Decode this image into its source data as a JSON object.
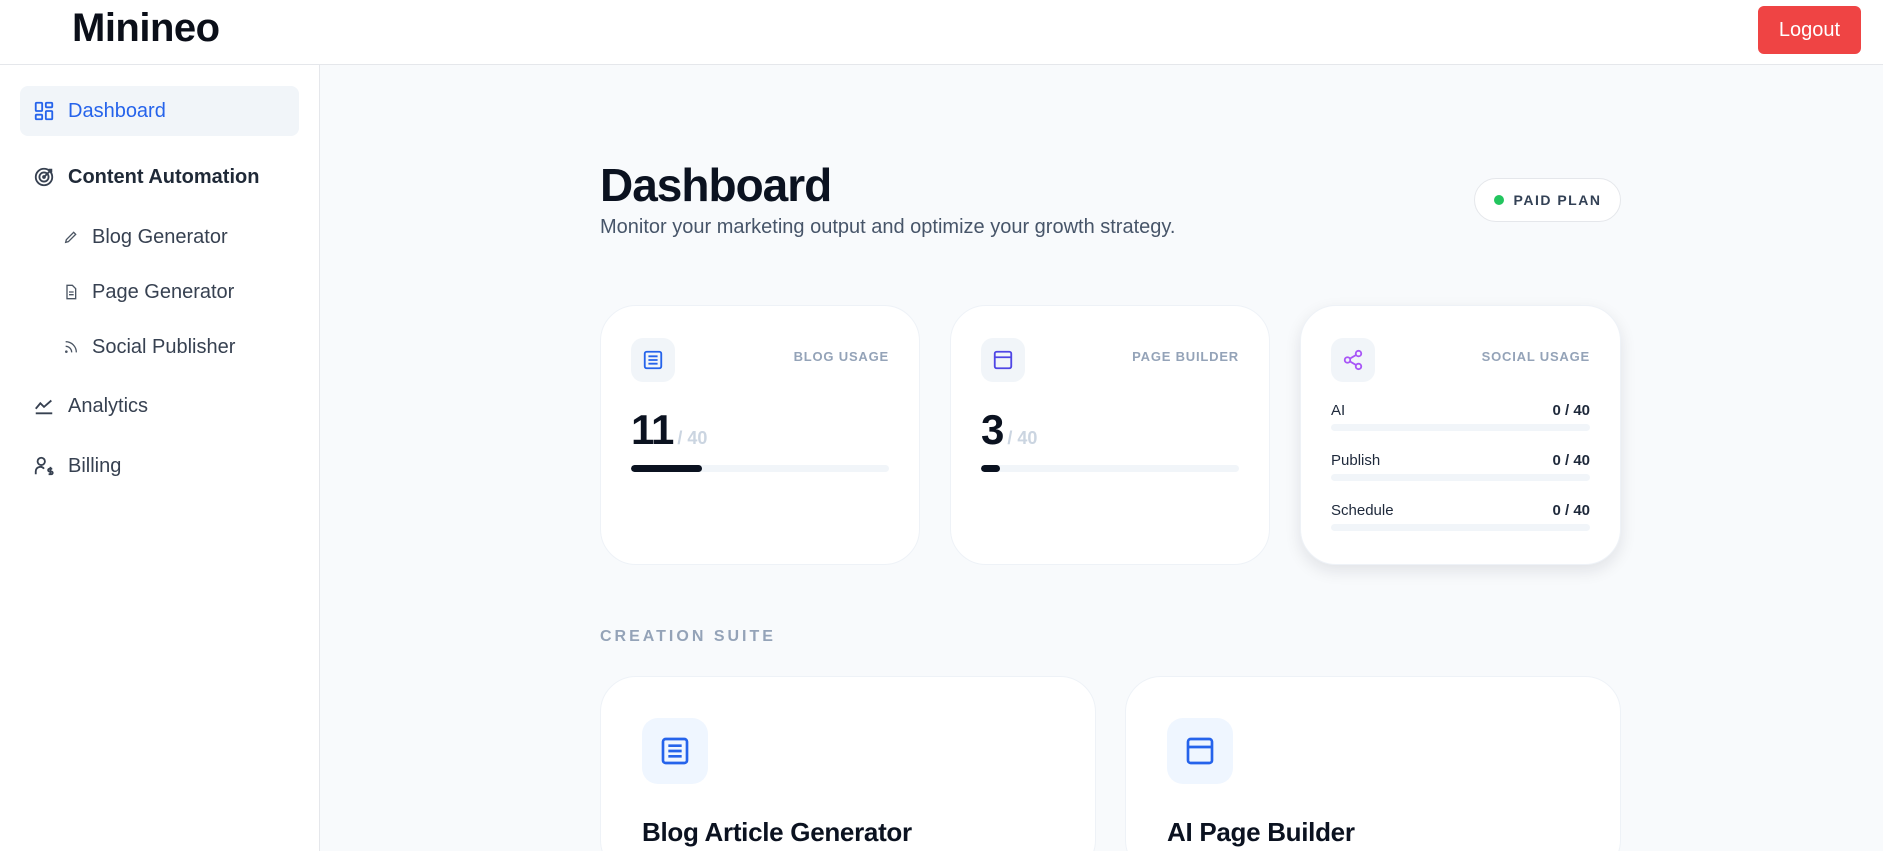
{
  "app": {
    "brand": "Minineo",
    "logout_label": "Logout"
  },
  "sidebar": {
    "dashboard": "Dashboard",
    "content_automation": "Content Automation",
    "blog_generator": "Blog Generator",
    "page_generator": "Page Generator",
    "social_publisher": "Social Publisher",
    "analytics": "Analytics",
    "billing": "Billing"
  },
  "header": {
    "title": "Dashboard",
    "subtitle": "Monitor your marketing output and optimize your growth strategy.",
    "plan_badge": "PAID PLAN"
  },
  "usage": {
    "blog": {
      "label": "BLOG USAGE",
      "value": "11",
      "max": "/ 40",
      "progress": 0.275
    },
    "page": {
      "label": "PAGE BUILDER",
      "value": "3",
      "max": "/ 40",
      "progress": 0.075
    },
    "social": {
      "label": "SOCIAL USAGE",
      "rows": [
        {
          "label": "AI",
          "value": "0 / 40",
          "progress": 0
        },
        {
          "label": "Publish",
          "value": "0 / 40",
          "progress": 0
        },
        {
          "label": "Schedule",
          "value": "0 / 40",
          "progress": 0
        }
      ]
    }
  },
  "creation_suite": {
    "heading": "CREATION SUITE",
    "tools": [
      {
        "title": "Blog Article Generator",
        "icon": "document-list-icon"
      },
      {
        "title": "AI Page Builder",
        "icon": "browser-window-icon"
      }
    ]
  },
  "colors": {
    "accent_blue": "#2563eb",
    "logout_red": "#ef4444",
    "plan_green": "#22c55e",
    "social_purple": "#a855f7"
  }
}
